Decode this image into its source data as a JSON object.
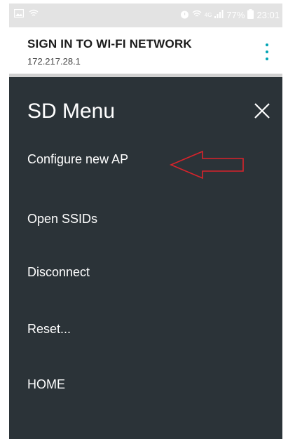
{
  "status_bar": {
    "battery": "77%",
    "time": "23:01",
    "network": "4G"
  },
  "header": {
    "title": "SIGN IN TO WI-FI NETWORK",
    "subtitle": "172.217.28.1"
  },
  "menu": {
    "title": "SD Menu",
    "items": [
      {
        "label": "Configure new AP"
      },
      {
        "label": "Open SSIDs"
      },
      {
        "label": "Disconnect"
      },
      {
        "label": "Reset..."
      },
      {
        "label": "HOME"
      }
    ]
  },
  "colors": {
    "menu_background": "#2b3338",
    "accent": "#00a4b4",
    "annotation": "#d9232b"
  },
  "icons": [
    "image-icon",
    "wifi-icon",
    "alarm-icon",
    "wifi-calling-icon",
    "signal-icon",
    "battery-icon",
    "overflow-menu-icon",
    "close-icon",
    "annotation-arrow-icon"
  ]
}
